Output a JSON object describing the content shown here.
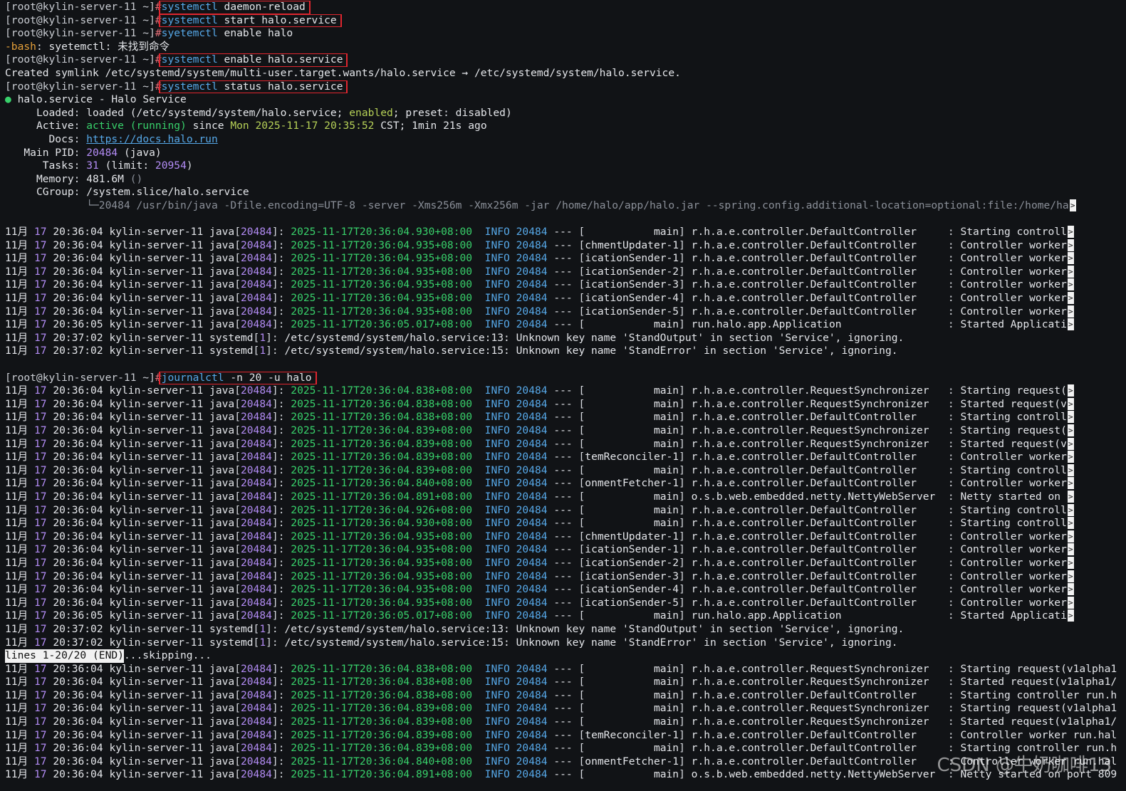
{
  "prompt": "[root@kylin-server-11 ~]",
  "prompt_hash": "#",
  "commands": [
    {
      "cmd": "systemctl",
      "args": "daemon-reload",
      "boxed": true
    },
    {
      "cmd": "systemctl",
      "args": "start halo.service",
      "boxed": true
    },
    {
      "cmd": "syetemctl",
      "args": "enable halo",
      "boxed": false
    }
  ],
  "bash_error": {
    "prefix": "-bash",
    "text": ": syetemctl: 未找到命令"
  },
  "enable_cmd": {
    "cmd": "systemctl",
    "args": "enable halo.service"
  },
  "symlink_line": "Created symlink /etc/systemd/system/multi-user.target.wants/halo.service → /etc/systemd/system/halo.service.",
  "status_cmd": {
    "cmd": "systemctl",
    "args": "status halo.service"
  },
  "status": {
    "header": "halo.service - Halo Service",
    "loaded_label": "Loaded",
    "loaded_value": "loaded (/etc/systemd/system/halo.service;",
    "enabled_text": "enabled",
    "preset_label": "preset",
    "preset_value": "disabled)",
    "active_label": "Active",
    "active_value": "active (running)",
    "active_since": "since",
    "active_date": "Mon 2025-11-17 20:35:52",
    "active_tail": "CST; 1min 21s ago",
    "docs_label": "Docs",
    "docs_url": "https://docs.halo.run",
    "pid_label": "Main PID",
    "pid_value": "20484",
    "pid_name": "(java)",
    "tasks_label": "Tasks",
    "tasks_value": "31",
    "tasks_limit_label": "(limit:",
    "tasks_limit": "20954",
    "memory_label": "Memory",
    "memory_value": "481.6M",
    "memory_paren": "()",
    "cgroup_label": "CGroup",
    "cgroup_value": "/system.slice/halo.service",
    "cgroup_proc": "└─20484 /usr/bin/java -Dfile.encoding=UTF-8 -server -Xms256m -Xmx256m -jar /home/halo/app/halo.jar --spring.config.additional-location=optional:file:/home/ha"
  },
  "log_prefix": {
    "month": "11月",
    "day": "17",
    "host": "kylin-server-11",
    "java": "java",
    "java_pid": "20484",
    "systemd": "systemd",
    "systemd_pid": "1"
  },
  "status_logs": [
    {
      "t": "20:36:04",
      "ts": "2025-11-17T20:36:04.930+08:00",
      "thread": "           main",
      "cls": "r.h.a.e.controller.DefaultController    ",
      "msg": "Starting controll",
      "trunc": true
    },
    {
      "t": "20:36:04",
      "ts": "2025-11-17T20:36:04.935+08:00",
      "thread": "chmentUpdater-1",
      "cls": "r.h.a.e.controller.DefaultController    ",
      "msg": "Controller worker",
      "trunc": true
    },
    {
      "t": "20:36:04",
      "ts": "2025-11-17T20:36:04.935+08:00",
      "thread": "icationSender-1",
      "cls": "r.h.a.e.controller.DefaultController    ",
      "msg": "Controller worker",
      "trunc": true
    },
    {
      "t": "20:36:04",
      "ts": "2025-11-17T20:36:04.935+08:00",
      "thread": "icationSender-2",
      "cls": "r.h.a.e.controller.DefaultController    ",
      "msg": "Controller worker",
      "trunc": true
    },
    {
      "t": "20:36:04",
      "ts": "2025-11-17T20:36:04.935+08:00",
      "thread": "icationSender-3",
      "cls": "r.h.a.e.controller.DefaultController    ",
      "msg": "Controller worker",
      "trunc": true
    },
    {
      "t": "20:36:04",
      "ts": "2025-11-17T20:36:04.935+08:00",
      "thread": "icationSender-4",
      "cls": "r.h.a.e.controller.DefaultController    ",
      "msg": "Controller worker",
      "trunc": true
    },
    {
      "t": "20:36:04",
      "ts": "2025-11-17T20:36:04.935+08:00",
      "thread": "icationSender-5",
      "cls": "r.h.a.e.controller.DefaultController    ",
      "msg": "Controller worker",
      "trunc": true
    },
    {
      "t": "20:36:05",
      "ts": "2025-11-17T20:36:05.017+08:00",
      "thread": "           main",
      "cls": "run.halo.app.Application                ",
      "msg": "Started Applicati",
      "trunc": true
    },
    {
      "t": "20:37:02",
      "systemd": true,
      "msg": "/etc/systemd/system/halo.service:13: Unknown key name 'StandOutput' in section 'Service', ignoring."
    },
    {
      "t": "20:37:02",
      "systemd": true,
      "msg": "/etc/systemd/system/halo.service:15: Unknown key name 'StandError' in section 'Service', ignoring."
    }
  ],
  "journal_cmd": {
    "cmd": "journalctl",
    "args": "-n 20 -u halo"
  },
  "journal_logs": [
    {
      "t": "20:36:04",
      "ts": "2025-11-17T20:36:04.838+08:00",
      "thread": "           main",
      "cls": "r.h.a.e.controller.RequestSynchronizer  ",
      "msg": "Starting request(",
      "trunc": true
    },
    {
      "t": "20:36:04",
      "ts": "2025-11-17T20:36:04.838+08:00",
      "thread": "           main",
      "cls": "r.h.a.e.controller.RequestSynchronizer  ",
      "msg": "Started request(v",
      "trunc": true
    },
    {
      "t": "20:36:04",
      "ts": "2025-11-17T20:36:04.838+08:00",
      "thread": "           main",
      "cls": "r.h.a.e.controller.DefaultController    ",
      "msg": "Starting controll",
      "trunc": true
    },
    {
      "t": "20:36:04",
      "ts": "2025-11-17T20:36:04.839+08:00",
      "thread": "           main",
      "cls": "r.h.a.e.controller.RequestSynchronizer  ",
      "msg": "Starting request(",
      "trunc": true
    },
    {
      "t": "20:36:04",
      "ts": "2025-11-17T20:36:04.839+08:00",
      "thread": "           main",
      "cls": "r.h.a.e.controller.RequestSynchronizer  ",
      "msg": "Started request(v",
      "trunc": true
    },
    {
      "t": "20:36:04",
      "ts": "2025-11-17T20:36:04.839+08:00",
      "thread": "temReconciler-1",
      "cls": "r.h.a.e.controller.DefaultController    ",
      "msg": "Controller worker",
      "trunc": true
    },
    {
      "t": "20:36:04",
      "ts": "2025-11-17T20:36:04.839+08:00",
      "thread": "           main",
      "cls": "r.h.a.e.controller.DefaultController    ",
      "msg": "Starting controll",
      "trunc": true
    },
    {
      "t": "20:36:04",
      "ts": "2025-11-17T20:36:04.840+08:00",
      "thread": "onmentFetcher-1",
      "cls": "r.h.a.e.controller.DefaultController    ",
      "msg": "Controller worker",
      "trunc": true
    },
    {
      "t": "20:36:04",
      "ts": "2025-11-17T20:36:04.891+08:00",
      "thread": "           main",
      "cls": "o.s.b.web.embedded.netty.NettyWebServer ",
      "msg": "Netty started on ",
      "trunc": true
    },
    {
      "t": "20:36:04",
      "ts": "2025-11-17T20:36:04.926+08:00",
      "thread": "           main",
      "cls": "r.h.a.e.controller.DefaultController    ",
      "msg": "Starting controll",
      "trunc": true
    },
    {
      "t": "20:36:04",
      "ts": "2025-11-17T20:36:04.930+08:00",
      "thread": "           main",
      "cls": "r.h.a.e.controller.DefaultController    ",
      "msg": "Starting controll",
      "trunc": true
    },
    {
      "t": "20:36:04",
      "ts": "2025-11-17T20:36:04.935+08:00",
      "thread": "chmentUpdater-1",
      "cls": "r.h.a.e.controller.DefaultController    ",
      "msg": "Controller worker",
      "trunc": true
    },
    {
      "t": "20:36:04",
      "ts": "2025-11-17T20:36:04.935+08:00",
      "thread": "icationSender-1",
      "cls": "r.h.a.e.controller.DefaultController    ",
      "msg": "Controller worker",
      "trunc": true
    },
    {
      "t": "20:36:04",
      "ts": "2025-11-17T20:36:04.935+08:00",
      "thread": "icationSender-2",
      "cls": "r.h.a.e.controller.DefaultController    ",
      "msg": "Controller worker",
      "trunc": true
    },
    {
      "t": "20:36:04",
      "ts": "2025-11-17T20:36:04.935+08:00",
      "thread": "icationSender-3",
      "cls": "r.h.a.e.controller.DefaultController    ",
      "msg": "Controller worker",
      "trunc": true
    },
    {
      "t": "20:36:04",
      "ts": "2025-11-17T20:36:04.935+08:00",
      "thread": "icationSender-4",
      "cls": "r.h.a.e.controller.DefaultController    ",
      "msg": "Controller worker",
      "trunc": true
    },
    {
      "t": "20:36:04",
      "ts": "2025-11-17T20:36:04.935+08:00",
      "thread": "icationSender-5",
      "cls": "r.h.a.e.controller.DefaultController    ",
      "msg": "Controller worker",
      "trunc": true
    },
    {
      "t": "20:36:05",
      "ts": "2025-11-17T20:36:05.017+08:00",
      "thread": "           main",
      "cls": "run.halo.app.Application                ",
      "msg": "Started Applicati",
      "trunc": true
    },
    {
      "t": "20:37:02",
      "systemd": true,
      "msg": "/etc/systemd/system/halo.service:13: Unknown key name 'StandOutput' in section 'Service', ignoring."
    },
    {
      "t": "20:37:02",
      "systemd": true,
      "msg": "/etc/systemd/system/halo.service:15: Unknown key name 'StandError' in section 'Service', ignoring."
    }
  ],
  "pager_status": "lines 1-20/20 (END)",
  "pager_tail": "...skipping...",
  "skipped_logs": [
    {
      "t": "20:36:04",
      "ts": "2025-11-17T20:36:04.838+08:00",
      "thread": "           main",
      "cls": "r.h.a.e.controller.RequestSynchronizer  ",
      "msg": "Starting request(v1alpha1"
    },
    {
      "t": "20:36:04",
      "ts": "2025-11-17T20:36:04.838+08:00",
      "thread": "           main",
      "cls": "r.h.a.e.controller.RequestSynchronizer  ",
      "msg": "Started request(v1alpha1/"
    },
    {
      "t": "20:36:04",
      "ts": "2025-11-17T20:36:04.838+08:00",
      "thread": "           main",
      "cls": "r.h.a.e.controller.DefaultController    ",
      "msg": "Starting controller run.h"
    },
    {
      "t": "20:36:04",
      "ts": "2025-11-17T20:36:04.839+08:00",
      "thread": "           main",
      "cls": "r.h.a.e.controller.RequestSynchronizer  ",
      "msg": "Starting request(v1alpha1"
    },
    {
      "t": "20:36:04",
      "ts": "2025-11-17T20:36:04.839+08:00",
      "thread": "           main",
      "cls": "r.h.a.e.controller.RequestSynchronizer  ",
      "msg": "Started request(v1alpha1/"
    },
    {
      "t": "20:36:04",
      "ts": "2025-11-17T20:36:04.839+08:00",
      "thread": "temReconciler-1",
      "cls": "r.h.a.e.controller.DefaultController    ",
      "msg": "Controller worker run.hal"
    },
    {
      "t": "20:36:04",
      "ts": "2025-11-17T20:36:04.839+08:00",
      "thread": "           main",
      "cls": "r.h.a.e.controller.DefaultController    ",
      "msg": "Starting controller run.h"
    },
    {
      "t": "20:36:04",
      "ts": "2025-11-17T20:36:04.840+08:00",
      "thread": "onmentFetcher-1",
      "cls": "r.h.a.e.controller.DefaultController    ",
      "msg": "Controller worker run.hal"
    },
    {
      "t": "20:36:04",
      "ts": "2025-11-17T20:36:04.891+08:00",
      "thread": "           main",
      "cls": "o.s.b.web.embedded.netty.NettyWebServer ",
      "msg": "Netty started on port 809"
    }
  ],
  "log_level": "INFO",
  "log_pid": "20484",
  "log_sep": "---",
  "trunc_glyph": ">",
  "watermark": "CSDN @牛奶咖啡13",
  "colors": {
    "accent_box": "#e0262f",
    "background": "#111316",
    "active_green": "#38d16b",
    "info_blue": "#56a8e8"
  }
}
